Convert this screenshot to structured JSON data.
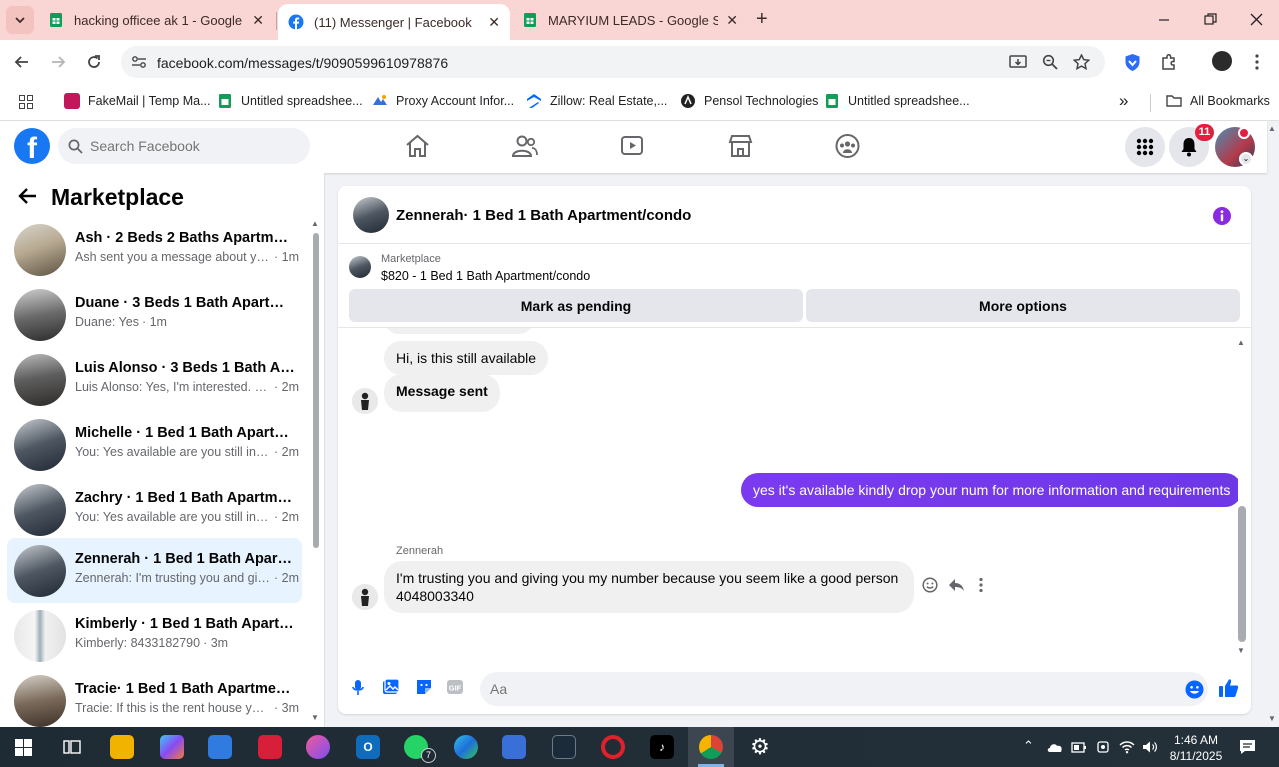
{
  "browser": {
    "tabs": [
      {
        "title": "hacking officee ak 1 - Google Sh",
        "close": "✕",
        "favicon": "sheets-icon"
      },
      {
        "title": "(11) Messenger | Facebook",
        "close": "✕",
        "favicon": "facebook-icon"
      },
      {
        "title": "MARYIUM LEADS - Google Shee",
        "close": "✕",
        "favicon": "sheets-icon"
      }
    ],
    "new_tab": "+",
    "url": "facebook.com/messages/t/9090599610978876",
    "bookmarks": [
      {
        "label": "FakeMail | Temp Ma...",
        "icon": "fakemail-icon"
      },
      {
        "label": "Untitled spreadshee...",
        "icon": "sheets-icon"
      },
      {
        "label": "Proxy Account Infor...",
        "icon": "proxy-icon"
      },
      {
        "label": "Zillow: Real Estate,...",
        "icon": "zillow-icon"
      },
      {
        "label": "Pensol Technologies",
        "icon": "pensol-icon"
      },
      {
        "label": "Untitled spreadshee...",
        "icon": "sheets-icon"
      }
    ],
    "more_bookmarks": "»",
    "all_bookmarks": "All Bookmarks",
    "colors": {
      "tabbar": "#f9d6d3",
      "accent": "#1877f2"
    }
  },
  "fb": {
    "search_placeholder": "Search Facebook",
    "notifications_count": "11",
    "logo": "f"
  },
  "left_pane": {
    "back": "←",
    "title": "Marketplace",
    "conversations": [
      {
        "name": "Ash · 2 Beds 2 Baths Apartment...",
        "preview": "Ash sent you a message about yo...",
        "time": "· 1m",
        "active": false
      },
      {
        "name": "Duane · 3 Beds 1 Bath Apartmen...",
        "preview": "Duane: Yes",
        "time": "· 1m",
        "active": false
      },
      {
        "name": "Luis Alonso · 3 Beds 1 Bath Apar...",
        "preview": "Luis Alonso: Yes, I'm interested. M...",
        "time": "· 2m",
        "active": false
      },
      {
        "name": "Michelle · 1 Bed 1 Bath Apartme...",
        "preview": "You: Yes available are you still inter...",
        "time": "· 2m",
        "active": false
      },
      {
        "name": "Zachry · 1 Bed 1 Bath Apartment...",
        "preview": "You: Yes available are you still inter...",
        "time": "· 2m",
        "active": false
      },
      {
        "name": "Zennerah · 1 Bed 1 Bath Apartm...",
        "preview": "Zennerah: I'm trusting you and giv...",
        "time": "· 2m",
        "active": true
      },
      {
        "name": "Kimberly · 1 Bed 1 Bath Apartme...",
        "preview": "Kimberly: 8433182790",
        "time": "· 3m",
        "active": false
      },
      {
        "name": "Tracie· 1 Bed 1 Bath Apartment/...",
        "preview": "Tracie: If this is the rent house you'...",
        "time": "· 3m",
        "active": false
      }
    ]
  },
  "chat": {
    "title": "Zennerah· 1 Bed 1 Bath Apartment/condo",
    "listing_source": "Marketplace",
    "listing_title": "$820 - 1 Bed 1 Bath Apartment/condo",
    "btn_pending": "Mark as pending",
    "btn_more": "More options",
    "messages": {
      "m1": "Hi, is this still available",
      "m2": "Message sent",
      "m3": "yes it's available kindly drop your num for more information and requirements",
      "sender": "Zennerah",
      "m4_line1": "I'm trusting you and giving you my number because you seem like a good person",
      "m4_line2": "4048003340"
    },
    "composer_placeholder": "Aa",
    "colors": {
      "outgoing": "#7b3af0",
      "info": "#8a2be2"
    }
  },
  "taskbar": {
    "time": "1:46 AM",
    "date": "8/11/2025",
    "whatsapp_badge": "7"
  }
}
